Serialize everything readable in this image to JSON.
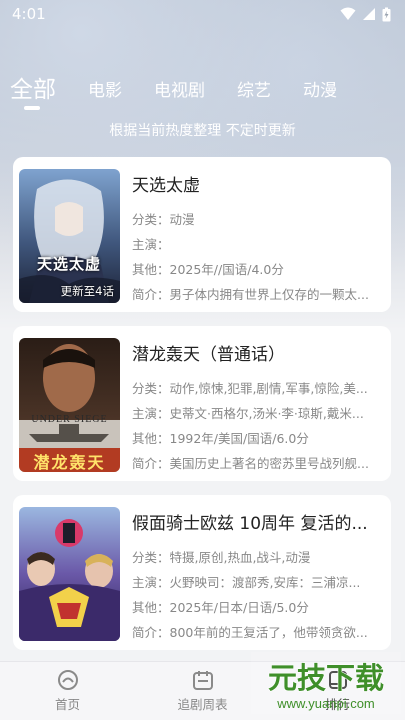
{
  "status": {
    "time": "4:01"
  },
  "tabs": [
    "全部",
    "电影",
    "电视剧",
    "综艺",
    "动漫"
  ],
  "subtitle": "根据当前热度整理 不定时更新",
  "cards": [
    {
      "title": "天选太虚",
      "category": "分类：动漫",
      "cast": "主演：",
      "other": "其他：2025年//国语/4.0分",
      "intro": "简介：男子体内拥有世界上仅存的一颗太...",
      "badge": "更新至4话",
      "poster_text": "天选太虚"
    },
    {
      "title": "潜龙轰天（普通话）",
      "category": "分类：动作,惊悚,犯罪,剧情,军事,惊险,美...",
      "cast": "主演：史蒂文·西格尔,汤米·李·琼斯,戴米...",
      "other": "其他：1992年/美国/国语/6.0分",
      "intro": "简介：美国历史上著名的密苏里号战列舰...",
      "poster_text_en": "UNDER SIEGE",
      "poster_text": "潜龙轰天"
    },
    {
      "title": "假面骑士欧兹 10周年 复活的...",
      "category": "分类：特摄,原创,热血,战斗,动漫",
      "cast": "主演：火野映司：渡部秀,安库：三浦凉...",
      "other": "其他：2025年/日本/日语/5.0分",
      "intro": "简介：800年前的王复活了，他带领贪欲..."
    }
  ],
  "nav": [
    "首页",
    "追剧周表",
    "排行"
  ],
  "watermark": {
    "main": "元技下载",
    "url": "www.yuanpi.com"
  }
}
